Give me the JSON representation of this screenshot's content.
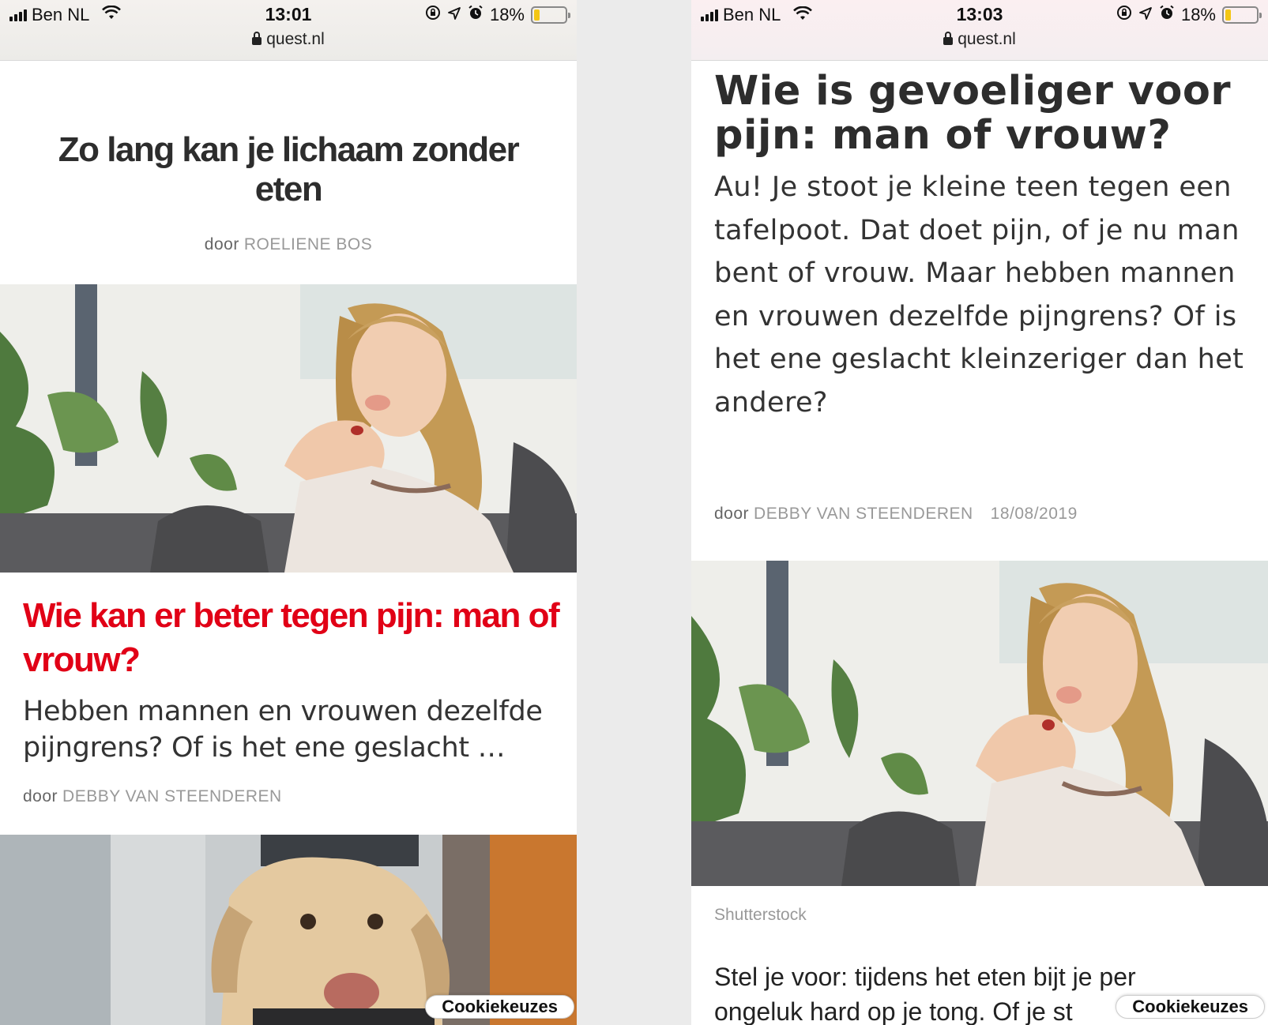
{
  "left": {
    "status": {
      "carrier": "Ben NL",
      "time": "13:01",
      "battery": "18%",
      "battery_level": 0.18,
      "battery_color": "#f3c614"
    },
    "url": "quest.nl",
    "teaser": {
      "title": "Zo lang kan je lichaam zonder eten",
      "door": "door",
      "author": "ROELIENE BOS"
    },
    "featured": {
      "title": "Wie kan er beter tegen pijn: man of vrouw?",
      "title_color": "#e10016",
      "excerpt": "Hebben mannen en vrouwen dezelfde pijngrens? Of is het ene geslacht …",
      "door": "door",
      "author": "DEBBY VAN STEENDEREN"
    },
    "cookie_label": "Cookiekeuzes"
  },
  "right": {
    "status": {
      "carrier": "Ben NL",
      "time": "13:03",
      "battery": "18%",
      "battery_level": 0.18
    },
    "url": "quest.nl",
    "article": {
      "title": "Wie is gevoeliger voor pijn: man of vrouw?",
      "intro": "Au! Je stoot je kleine teen tegen een tafelpoot. Dat doet pijn, of je nu man bent of vrouw. Maar hebben mannen en vrouwen dezelfde pijngrens? Of is het ene geslacht kleinzeriger dan het andere?",
      "door": "door",
      "author": "DEBBY VAN STEENDEREN",
      "date": "18/08/2019",
      "photo_credit": "Shutterstock",
      "body_line1": "Stel je voor: tijdens het eten bijt je per",
      "body_line2": "ongeluk hard op je tong. Of je st"
    },
    "cookie_label": "Cookiekeuzes"
  }
}
